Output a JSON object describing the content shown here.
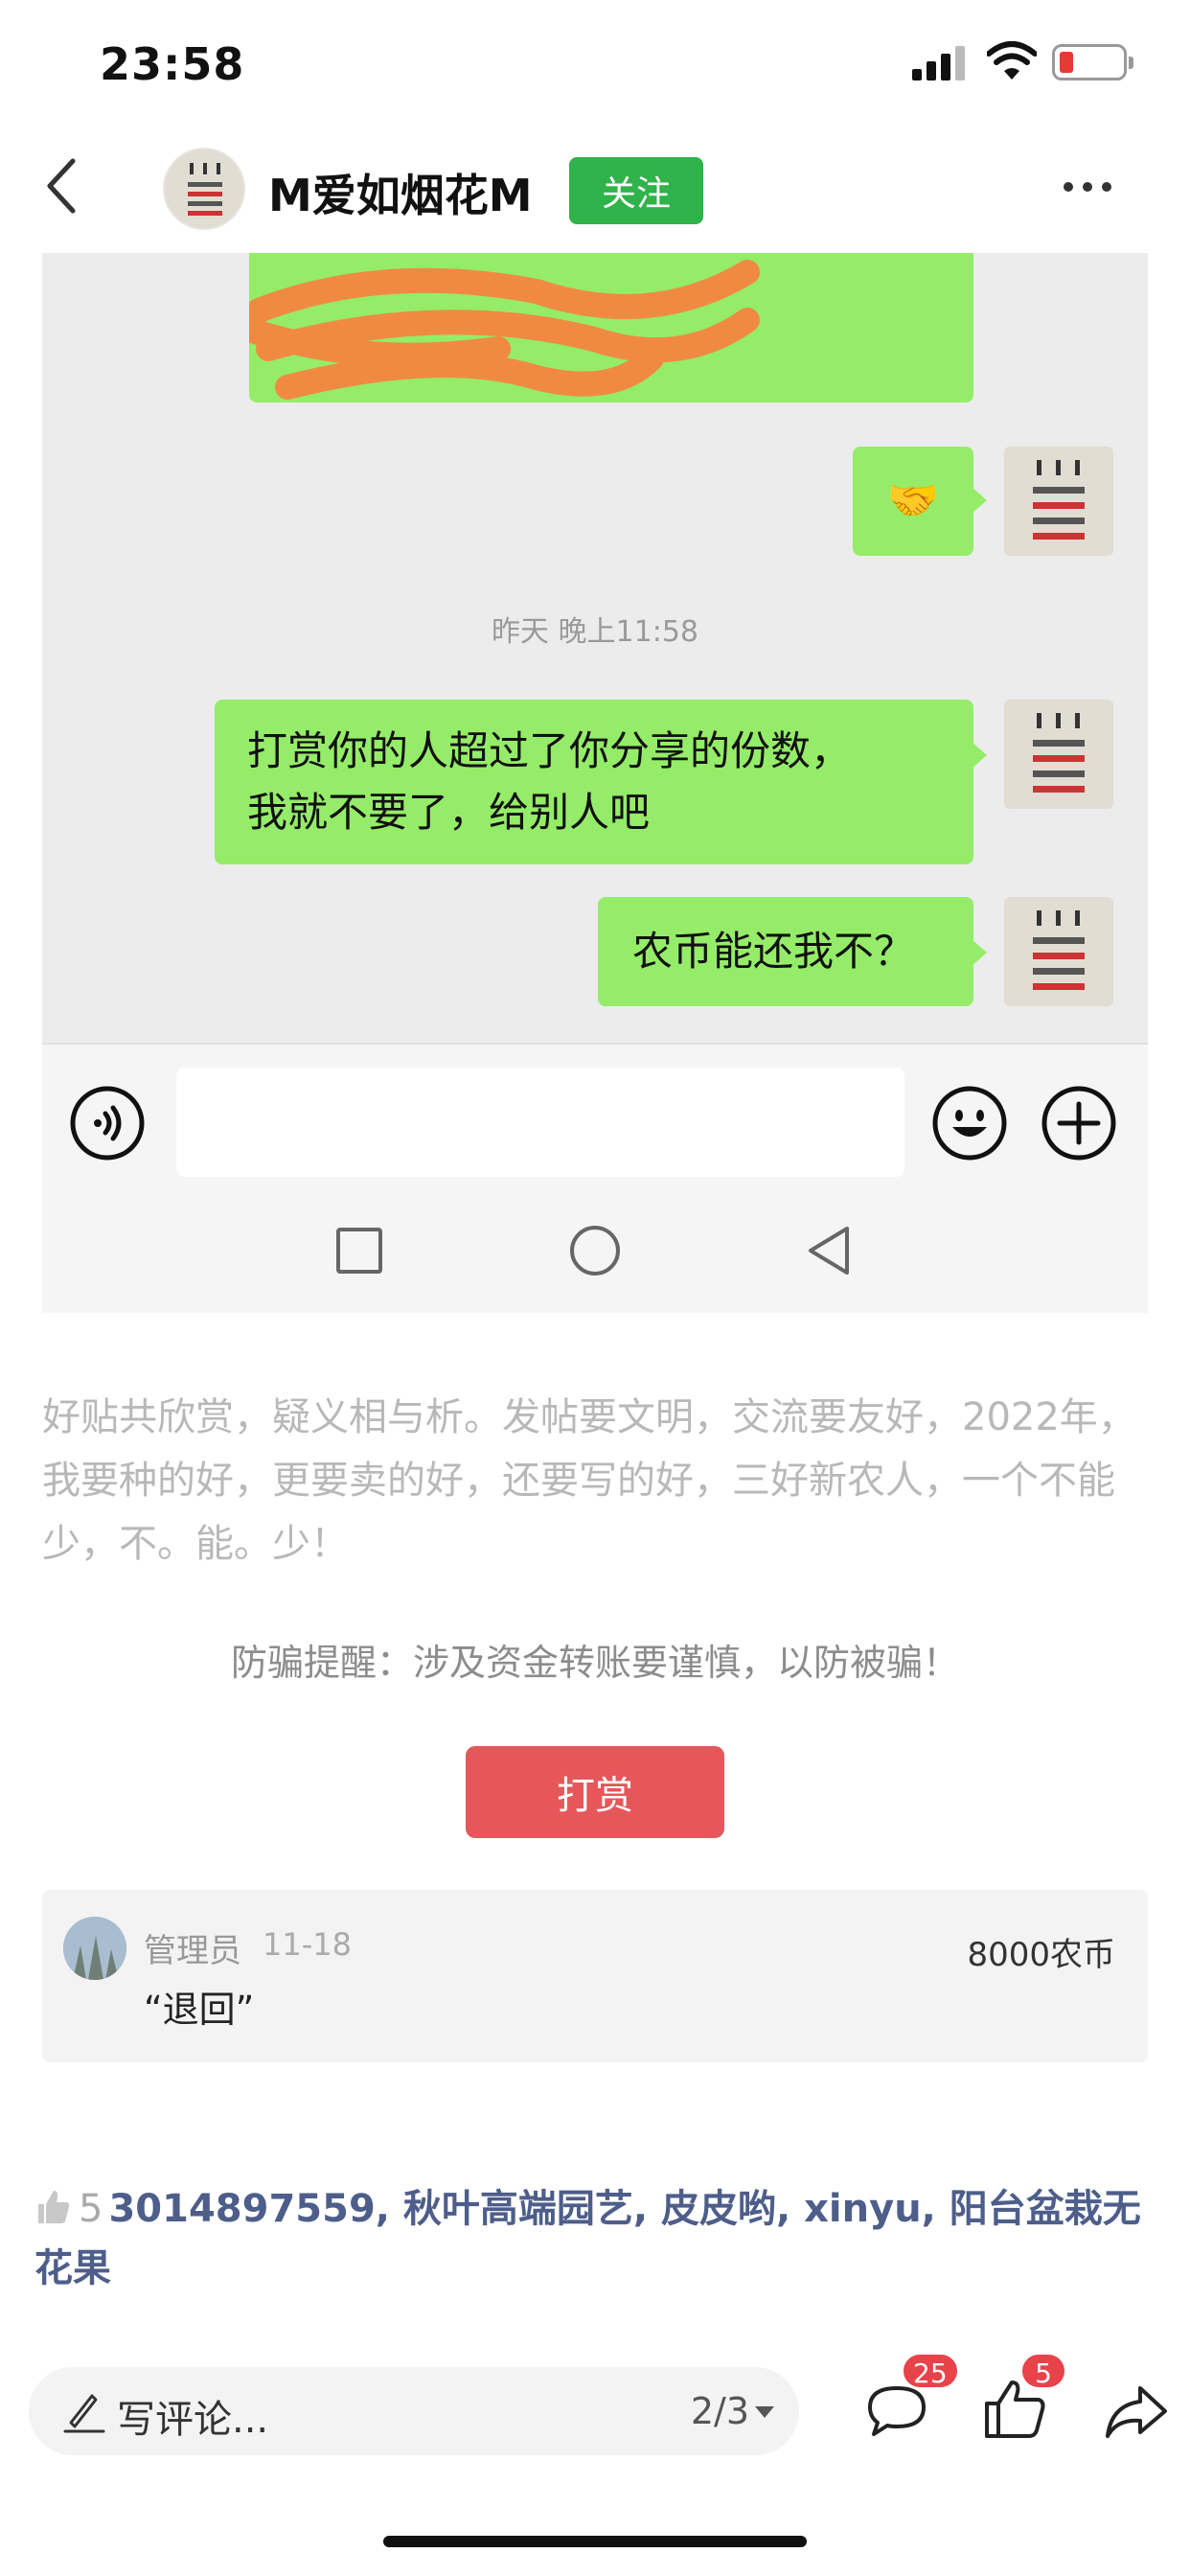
{
  "status_bar": {
    "time": "23:58"
  },
  "header": {
    "username": "M爱如烟花M",
    "follow_label": "关注"
  },
  "chat": {
    "timestamp": "昨天 晚上11:58",
    "messages": [
      {
        "text": "🤝"
      },
      {
        "line1": "打赏你的人超过了你分享的份数，",
        "line2": "我就不要了，给别人吧"
      },
      {
        "text": "农币能还我不？"
      }
    ]
  },
  "post": {
    "intro": "好贴共欣赏，疑义相与析。发帖要文明，交流要友好，2022年，我要种的好，更要卖的好，还要写的好，三好新农人，一个不能少，不。能。少！",
    "warning": "防骗提醒：涉及资金转账要谨慎，以防被骗！",
    "reward_label": "打赏"
  },
  "reward_record": {
    "role": "管理员",
    "date": "11-18",
    "amount": "8000农币",
    "message": "“退回”"
  },
  "likes": {
    "count": "5",
    "users": "3014897559, 秋叶高端园艺, 皮皮哟, xinyu, 阳台盆栽无花果"
  },
  "bottom_bar": {
    "comment_placeholder": "写评论...",
    "page_indicator": "2/3",
    "comment_count": "25",
    "like_count": "5"
  }
}
